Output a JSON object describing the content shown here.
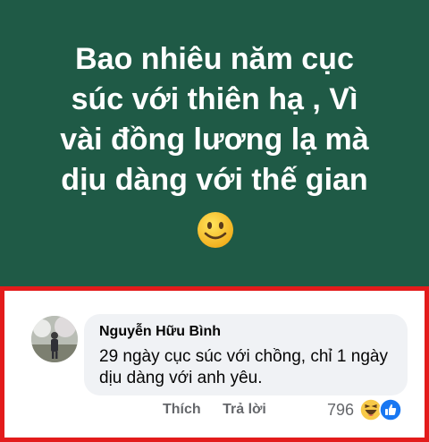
{
  "post": {
    "lines": [
      "Bao nhiêu năm cục",
      "súc với thiên hạ , Vì",
      "vài đồng lương lạ mà",
      "dịu dàng với thế gian"
    ],
    "emoji": "smiling-face",
    "background_color": "#1f5a46"
  },
  "comment": {
    "author": "Nguyễn Hữu Bình",
    "text": "29 ngày cục súc với chồng, chỉ 1 ngày dịu dàng với anh yêu.",
    "actions": {
      "like_label": "Thích",
      "reply_label": "Trả lời"
    },
    "reaction_count": "796",
    "reactions": [
      "haha-reaction-icon",
      "like-reaction-icon"
    ],
    "highlight_color": "#e31b1b"
  }
}
